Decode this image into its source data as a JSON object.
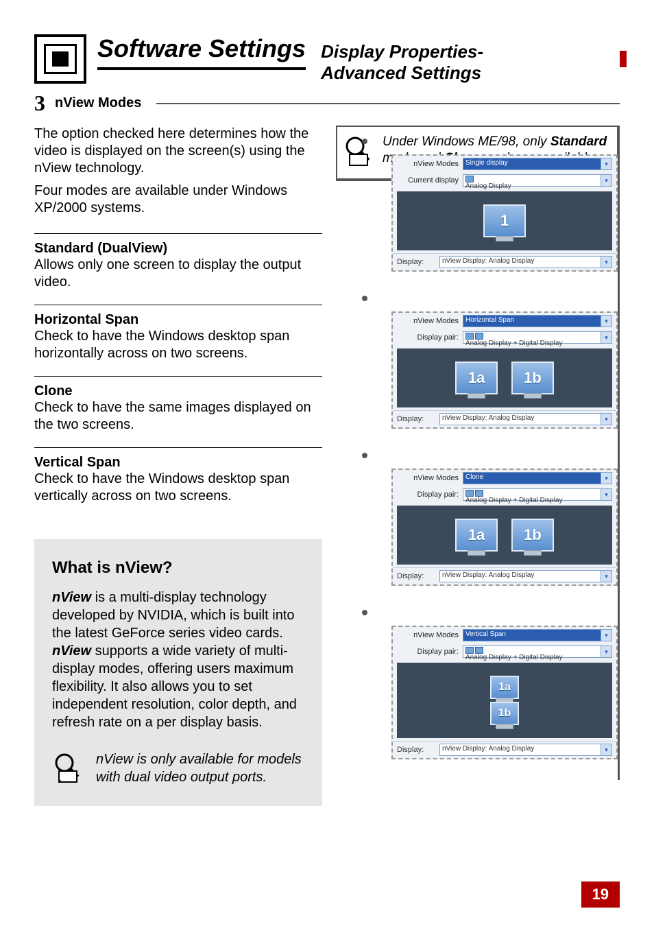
{
  "header": {
    "title": "Software Settings",
    "subtitle_line1": "Display Properties-",
    "subtitle_line2": "Advanced Settings"
  },
  "section": {
    "number": "3",
    "title": "nView Modes",
    "intro_p1": "The option checked here determines how the video is displayed on the screen(s) using the nView technology.",
    "intro_p2": "Four modes are available under Windows XP/2000 systems."
  },
  "top_note": {
    "prefix": "Under Windows ME/98, only ",
    "bold1": "Standard",
    "mid": " mode and ",
    "bold2": "Clone",
    "suffix": " mode are available."
  },
  "modes": [
    {
      "title": "Standard (DualView)",
      "desc": "Allows only one screen to display the output video."
    },
    {
      "title": "Horizontal Span",
      "desc": "Check to have the Windows desktop span horizontally across on two screens."
    },
    {
      "title": "Clone",
      "desc": "Check to have the same images displayed on the two screens."
    },
    {
      "title": "Vertical Span",
      "desc": "Check to have the Windows desktop span vertically across on two screens."
    }
  ],
  "what_is": {
    "heading": "What is nView?",
    "bold1": "nView",
    "p1_after": " is a multi-display technology developed by NVIDIA, which is built into the latest GeForce series video cards. ",
    "bold2": "nView",
    "p1_after2": " supports a wide variety of multi-display modes, offering users maximum flexibility.  It also allows you to set independent resolution, color depth, and refresh rate on a per display basis.",
    "note": "nView is only available for models with dual video output ports."
  },
  "panels_common": {
    "lbl_nview_modes": "nView Modes",
    "lbl_current_display": "Current display",
    "lbl_display_pair": "Display pair:",
    "lbl_display": "Display:",
    "val_analog": "Analog Display",
    "val_pair": "Analog Display + Digital Display",
    "val_nview_display": "nView Display: Analog Display"
  },
  "panels": {
    "single": {
      "mode": "Single display",
      "mon": [
        "1"
      ]
    },
    "hspan": {
      "mode": "Horizontal Span",
      "mon": [
        "1a",
        "1b"
      ]
    },
    "clone": {
      "mode": "Clone",
      "mon": [
        "1a",
        "1b"
      ]
    },
    "vspan": {
      "mode": "Vertical Span",
      "mon": [
        "1a",
        "1b"
      ]
    }
  },
  "footer": {
    "page": "19"
  }
}
